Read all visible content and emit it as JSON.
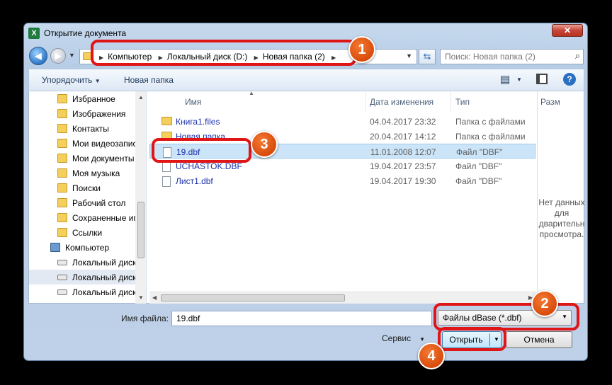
{
  "window": {
    "title": "Открытие документа",
    "app_icon": "X",
    "close_icon": "✕"
  },
  "nav": {
    "back_icon": "◀",
    "forward_icon": "▶"
  },
  "address": {
    "crumbs": [
      "Компьютер",
      "Локальный диск (D:)",
      "Новая папка (2)"
    ]
  },
  "search": {
    "placeholder": "Поиск: Новая папка (2)"
  },
  "toolbar": {
    "organize_label": "Упорядочить",
    "new_folder_label": "Новая папка"
  },
  "sidebar": {
    "items": [
      {
        "label": "Избранное",
        "icon": "star-folder-icon"
      },
      {
        "label": "Изображения",
        "icon": "folder-icon"
      },
      {
        "label": "Контакты",
        "icon": "folder-icon"
      },
      {
        "label": "Мои видеозапис",
        "icon": "folder-icon"
      },
      {
        "label": "Мои документы",
        "icon": "folder-icon"
      },
      {
        "label": "Моя музыка",
        "icon": "folder-icon"
      },
      {
        "label": "Поиски",
        "icon": "folder-icon"
      },
      {
        "label": "Рабочий стол",
        "icon": "folder-icon"
      },
      {
        "label": "Сохраненные иг",
        "icon": "folder-icon"
      },
      {
        "label": "Ссылки",
        "icon": "folder-icon"
      },
      {
        "label": "Компьютер",
        "icon": "computer-icon"
      },
      {
        "label": "Локальный диск",
        "icon": "drive-icon"
      },
      {
        "label": "Локальный диск",
        "icon": "drive-icon"
      },
      {
        "label": "Локальный диск",
        "icon": "drive-icon"
      }
    ]
  },
  "columns": {
    "name": "Имя",
    "date": "Дата изменения",
    "type": "Тип",
    "size": "Разм"
  },
  "files": [
    {
      "name": "Книга1.files",
      "date": "04.04.2017 23:32",
      "type": "Папка с файлами",
      "kind": "folder"
    },
    {
      "name": "Новая папка",
      "date": "20.04.2017 14:12",
      "type": "Папка с файлами",
      "kind": "folder"
    },
    {
      "name": "19.dbf",
      "date": "11.01.2008 12:07",
      "type": "Файл \"DBF\"",
      "kind": "file",
      "selected": true
    },
    {
      "name": "UCHASTOK.DBF",
      "date": "19.04.2017 23:57",
      "type": "Файл \"DBF\"",
      "kind": "file"
    },
    {
      "name": "Лист1.dbf",
      "date": "19.04.2017 19:30",
      "type": "Файл \"DBF\"",
      "kind": "file"
    }
  ],
  "preview": {
    "lines": [
      "Нет данных",
      "для",
      "дварительн",
      "просмотра."
    ]
  },
  "footer": {
    "filename_label": "Имя файла:",
    "filename_value": "19.dbf",
    "filetype_value": "Файлы dBase (*.dbf)",
    "service_label": "Сервис",
    "open_label": "Открыть",
    "cancel_label": "Отмена"
  },
  "annotations": {
    "badges": [
      "1",
      "2",
      "3",
      "4"
    ],
    "color": "#e01515",
    "badge_color": "#e2580f"
  }
}
